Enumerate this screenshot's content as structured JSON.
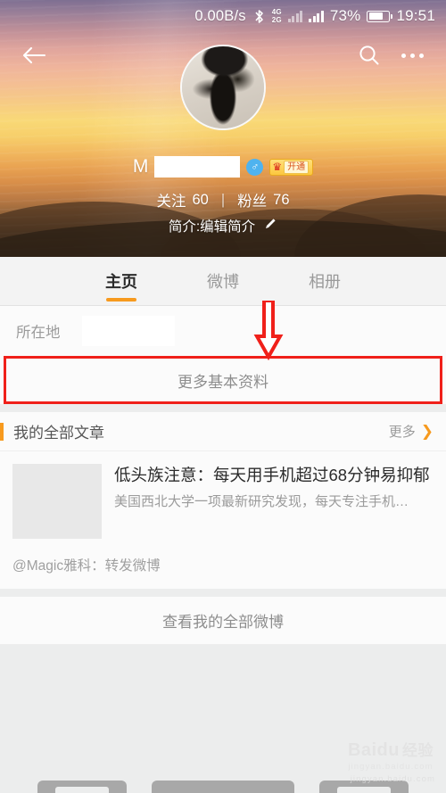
{
  "status_bar": {
    "network_speed": "0.00B/s",
    "bluetooth_icon": "bluetooth-icon",
    "dual_sim_label_top": "4G",
    "dual_sim_label_bottom": "2G",
    "signal_icon_1": "signal-bars-icon",
    "signal_icon_2": "signal-bars-icon",
    "battery_percent": "73%",
    "battery_icon": "battery-icon",
    "time": "19:51"
  },
  "nav": {
    "back_icon": "back-arrow-icon",
    "search_icon": "search-icon",
    "more_icon": "more-dots-icon"
  },
  "profile": {
    "avatar_icon": "avatar",
    "username_visible": "M",
    "username_redacted": true,
    "gender_icon": "male-gender-icon",
    "gender_symbol": "♂",
    "vip_crown_icon": "vip-crown-icon",
    "vip_crown_symbol": "♛",
    "vip_action_label": "开通",
    "following_label": "关注",
    "following_count": "60",
    "separator": "|",
    "followers_label": "粉丝",
    "followers_count": "76",
    "bio_label": "简介:编辑简介",
    "bio_edit_icon": "pencil-icon",
    "bio_edit_symbol": "✎"
  },
  "tabs": [
    {
      "label": "主页",
      "active": true
    },
    {
      "label": "微博",
      "active": false
    },
    {
      "label": "相册",
      "active": false
    }
  ],
  "info": {
    "location_label": "所在地",
    "location_value_redacted": true,
    "more_basic_info_label": "更多基本资料",
    "annotation_arrow_icon": "red-down-arrow-annotation",
    "annotation_box_color": "#f0201a"
  },
  "articles_section": {
    "title": "我的全部文章",
    "more_label": "更多",
    "more_chevron_icon": "chevron-right-icon",
    "more_chevron_symbol": "❯",
    "accent_color": "#f79a1e",
    "items": [
      {
        "thumbnail_icon": "article-thumbnail",
        "title": "低头族注意：每天用手机超过68分钟易抑郁",
        "summary": "美国西北大学一项最新研究发现，每天专注手机…",
        "repost": "@Magic雅科：转发微博"
      }
    ]
  },
  "footer": {
    "view_all_weibo_label": "查看我的全部微博"
  },
  "watermark": {
    "brand_latin": "Baidu",
    "brand_cn": "经验",
    "url": "jingyan.baidu.com"
  },
  "bottom_nav": {
    "recent_icon": "recent-apps-icon",
    "home_icon": "home-icon",
    "back_icon": "back-nav-icon"
  }
}
